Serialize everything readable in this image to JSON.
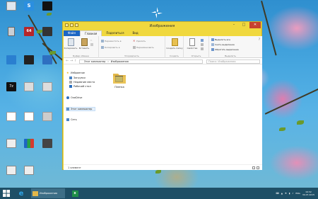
{
  "window": {
    "title": "Изображения",
    "tabs": [
      "Файл",
      "Главная",
      "Поделиться",
      "Вид"
    ],
    "ribbon": {
      "clipboard": {
        "copy": "Копировать",
        "paste": "Вставить",
        "label": "Буфер обмена"
      },
      "organize": {
        "move_to": "Переместить в",
        "copy_to": "Копировать в",
        "delete": "Удалить",
        "rename": "Переименовать",
        "label": "Упорядочить"
      },
      "create": {
        "new_folder": "Создать папку",
        "label": "Создать"
      },
      "open": {
        "properties": "Свойства",
        "label": "Открыть"
      },
      "select": {
        "select_all": "Выделить все",
        "select_none": "Снять выделение",
        "invert": "Обратить выделение",
        "label": "Выделить"
      }
    },
    "address": {
      "parts": [
        "Этот компьютер",
        "›",
        "Изображения"
      ],
      "search_placeholder": "Поиск: Изображения"
    },
    "nav": {
      "favorites": "Избранное",
      "downloads": "Загрузки",
      "recent": "Недавние места",
      "desktop": "Рабочий стол",
      "onedrive": "OneDrive",
      "this_pc": "Этот компьютер",
      "network": "Сеть"
    },
    "folder_name": "Пленка",
    "status": "1 элемент"
  },
  "taskbar": {
    "explorer_label": "Изображения",
    "lang": "ENG",
    "time": "19:32",
    "date": "30.07.2015"
  },
  "colors": {
    "window_frame": "#f0d83e",
    "file_tab": "#1c66c4",
    "taskbar": "#1e4f66",
    "close_button": "#c7412f"
  }
}
